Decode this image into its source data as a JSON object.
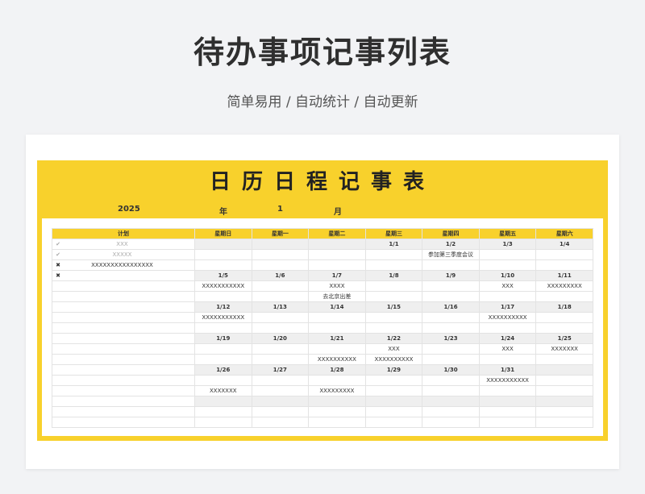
{
  "page": {
    "title": "待办事项记事列表",
    "subtitle": "简单易用 / 自动统计 / 自动更新"
  },
  "sheet": {
    "title": "日历日程记事表",
    "year": "2025",
    "year_label": "年",
    "month": "1",
    "month_label": "月",
    "plan_header": "计划",
    "weekdays": [
      "星期日",
      "星期一",
      "星期二",
      "星期三",
      "星期四",
      "星期五",
      "星期六"
    ],
    "plans": [
      {
        "mark": "✔",
        "text": "XXX",
        "done": true
      },
      {
        "mark": "✔",
        "text": "XXXXX",
        "done": true
      },
      {
        "mark": "✖",
        "text": "XXXXXXXXXXXXXXXX",
        "done": false
      },
      {
        "mark": "✖",
        "text": "",
        "done": false
      }
    ],
    "weeks": [
      {
        "dates": [
          "",
          "",
          "",
          "1/1",
          "1/2",
          "1/3",
          "1/4"
        ],
        "notes1": [
          "",
          "",
          "",
          "",
          "参加第三季度会议",
          "",
          ""
        ],
        "notes2": [
          "",
          "",
          "",
          "",
          "",
          "",
          ""
        ]
      },
      {
        "dates": [
          "1/5",
          "1/6",
          "1/7",
          "1/8",
          "1/9",
          "1/10",
          "1/11"
        ],
        "notes1": [
          "XXXXXXXXXXX",
          "",
          "XXXX",
          "",
          "",
          "XXX",
          "XXXXXXXXX"
        ],
        "notes2": [
          "",
          "",
          "去北京出差",
          "",
          "",
          "",
          ""
        ]
      },
      {
        "dates": [
          "1/12",
          "1/13",
          "1/14",
          "1/15",
          "1/16",
          "1/17",
          "1/18"
        ],
        "notes1": [
          "XXXXXXXXXXX",
          "",
          "",
          "",
          "",
          "XXXXXXXXXX",
          ""
        ],
        "notes2": [
          "",
          "",
          "",
          "",
          "",
          "",
          ""
        ]
      },
      {
        "dates": [
          "1/19",
          "1/20",
          "1/21",
          "1/22",
          "1/23",
          "1/24",
          "1/25"
        ],
        "notes1": [
          "",
          "",
          "",
          "XXX",
          "",
          "XXX",
          "XXXXXXX"
        ],
        "notes2": [
          "",
          "",
          "XXXXXXXXXX",
          "XXXXXXXXXX",
          "",
          "",
          ""
        ]
      },
      {
        "dates": [
          "1/26",
          "1/27",
          "1/28",
          "1/29",
          "1/30",
          "1/31",
          ""
        ],
        "notes1": [
          "",
          "",
          "",
          "",
          "",
          "XXXXXXXXXXX",
          ""
        ],
        "notes2": [
          "XXXXXXX",
          "",
          "XXXXXXXXX",
          "",
          "",
          "",
          ""
        ]
      },
      {
        "dates": [
          "",
          "",
          "",
          "",
          "",
          "",
          ""
        ],
        "notes1": [
          "",
          "",
          "",
          "",
          "",
          "",
          ""
        ],
        "notes2": [
          "",
          "",
          "",
          "",
          "",
          "",
          ""
        ]
      }
    ]
  }
}
